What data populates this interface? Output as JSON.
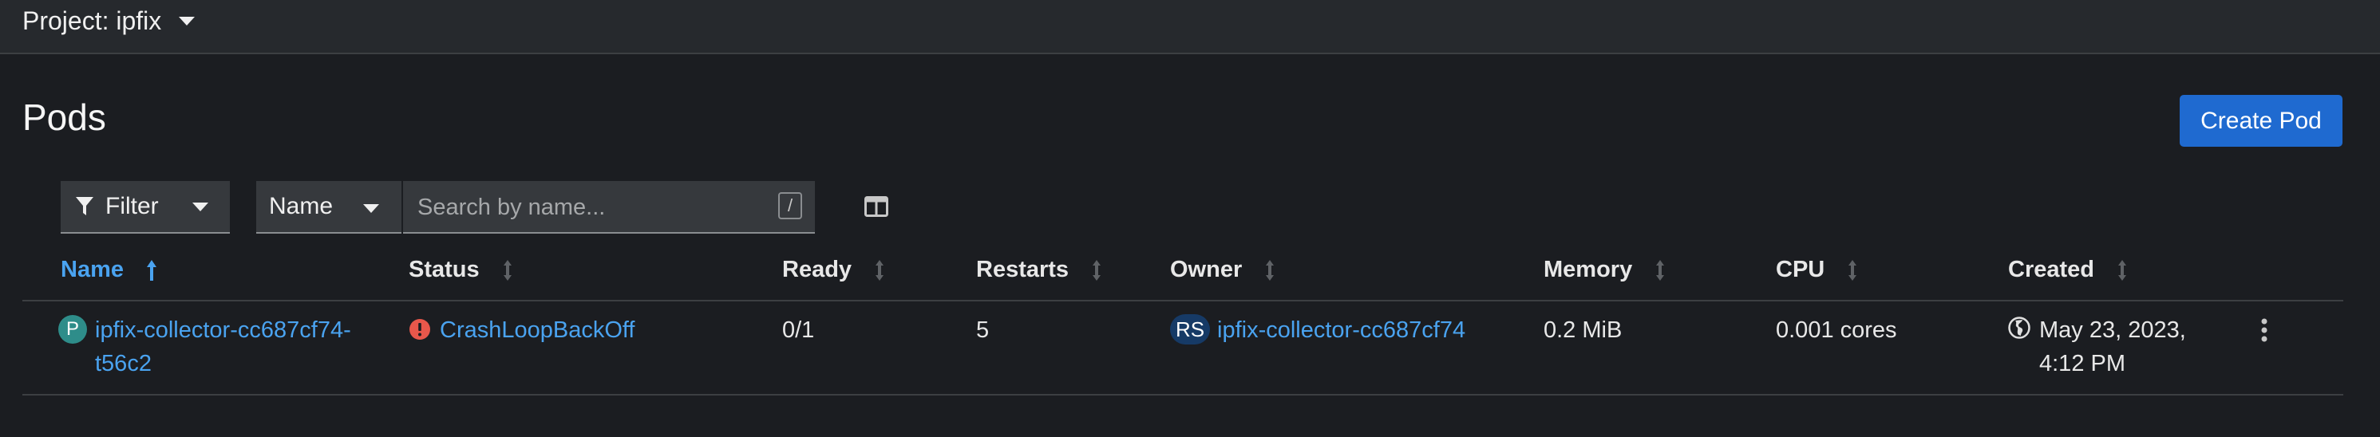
{
  "topbar": {
    "project_label": "Project: ipfix",
    "caret_icon": "caret-down-icon"
  },
  "page": {
    "title": "Pods",
    "create_button": "Create Pod"
  },
  "toolbar": {
    "filter_label": "Filter",
    "filter_icon": "filter-icon",
    "name_select_value": "Name",
    "search_placeholder": "Search by name...",
    "search_value": "",
    "search_shortcut": "/",
    "column_management_icon": "columns-icon"
  },
  "table": {
    "columns": [
      {
        "label": "Name",
        "sort": "ascending",
        "active": true
      },
      {
        "label": "Status"
      },
      {
        "label": "Ready"
      },
      {
        "label": "Restarts"
      },
      {
        "label": "Owner"
      },
      {
        "label": "Memory"
      },
      {
        "label": "CPU"
      },
      {
        "label": "Created"
      }
    ],
    "rows": [
      {
        "kind_badge": "P",
        "name_line1": "ipfix-collector-cc687cf74-",
        "name_line2": "t56c2",
        "status": "CrashLoopBackOff",
        "status_icon": "error-circle-icon",
        "ready": "0/1",
        "restarts": "5",
        "owner_badge": "RS",
        "owner": "ipfix-collector-cc687cf74",
        "memory": "0.2 MiB",
        "cpu": "0.001 cores",
        "created_icon": "globe-icon",
        "created_line1": "May 23, 2023,",
        "created_line2": "4:12 PM",
        "actions_icon": "kebab-menu-icon"
      }
    ]
  },
  "colors": {
    "background": "#1b1d21",
    "topbar": "#26292d",
    "link": "#4aa3f0",
    "primary_button": "#1f6ad0",
    "error": "#e8574b",
    "pod_badge": "#2e8d8a",
    "rs_badge": "#163a66"
  }
}
